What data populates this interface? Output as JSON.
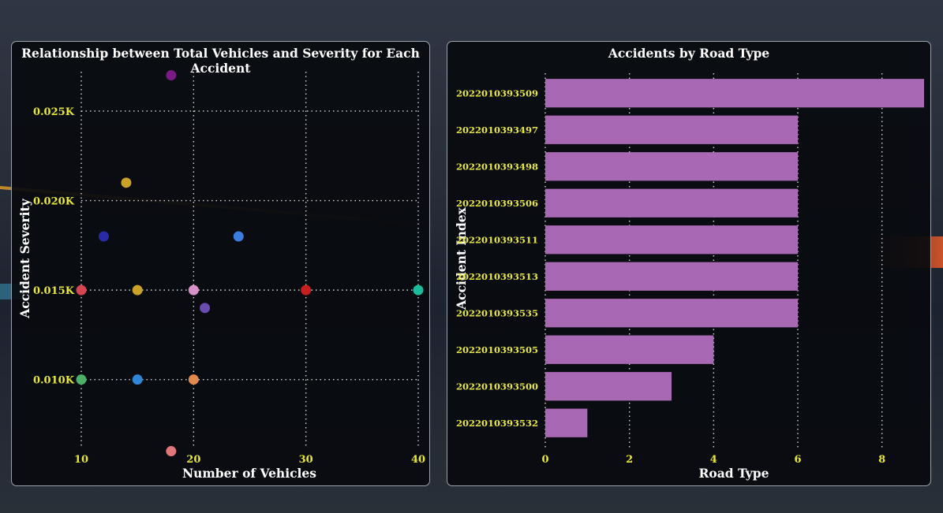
{
  "scatter_panel": {
    "title": "Relationship between Total Vehicles and Severity for Each Accident",
    "xlabel": "Number of Vehicles",
    "ylabel": "Accident Severity",
    "x_ticks": [
      10,
      20,
      30,
      40
    ],
    "y_ticks": [
      {
        "value": 0.01,
        "label": "0.010K"
      },
      {
        "value": 0.015,
        "label": "0.015K"
      },
      {
        "value": 0.02,
        "label": "0.020K"
      },
      {
        "value": 0.025,
        "label": "0.025K"
      }
    ]
  },
  "bar_panel": {
    "title": "Accidents by Road Type",
    "xlabel": "Road Type",
    "ylabel": "Accident Index",
    "x_ticks": [
      0,
      2,
      4,
      6,
      8
    ]
  },
  "chart_data": [
    {
      "type": "scatter",
      "title": "Relationship between Total Vehicles and Severity for Each Accident",
      "xlabel": "Number of Vehicles",
      "ylabel": "Accident Severity",
      "xlim": [
        10,
        40
      ],
      "ylim": [
        0.0062,
        0.0272
      ],
      "grid": true,
      "points": [
        {
          "x": 18,
          "y": 0.027,
          "color": "#7a1a86"
        },
        {
          "x": 14,
          "y": 0.021,
          "color": "#c9a227"
        },
        {
          "x": 12,
          "y": 0.018,
          "color": "#2a2aa8"
        },
        {
          "x": 24,
          "y": 0.018,
          "color": "#3a7ee0"
        },
        {
          "x": 10,
          "y": 0.015,
          "color": "#d64550"
        },
        {
          "x": 15,
          "y": 0.015,
          "color": "#c9a227"
        },
        {
          "x": 20,
          "y": 0.015,
          "color": "#d890c8"
        },
        {
          "x": 30,
          "y": 0.015,
          "color": "#c81e1e"
        },
        {
          "x": 40,
          "y": 0.015,
          "color": "#1abc9c"
        },
        {
          "x": 21,
          "y": 0.014,
          "color": "#6a4cb0"
        },
        {
          "x": 10,
          "y": 0.01,
          "color": "#4caf6a"
        },
        {
          "x": 15,
          "y": 0.01,
          "color": "#2f86d6"
        },
        {
          "x": 20,
          "y": 0.01,
          "color": "#e08a50"
        },
        {
          "x": 18,
          "y": 0.006,
          "color": "#e07878"
        }
      ]
    },
    {
      "type": "bar",
      "orientation": "horizontal",
      "title": "Accidents by Road Type",
      "xlabel": "Road Type",
      "ylabel": "Accident Index",
      "xlim": [
        0,
        9
      ],
      "grid": true,
      "color": "#a868b4",
      "categories": [
        "2022010393509",
        "2022010393497",
        "2022010393498",
        "2022010393506",
        "2022010393511",
        "2022010393513",
        "2022010393535",
        "2022010393505",
        "2022010393500",
        "2022010393532"
      ],
      "values": [
        9,
        6,
        6,
        6,
        6,
        6,
        6,
        4,
        3,
        1
      ]
    }
  ]
}
